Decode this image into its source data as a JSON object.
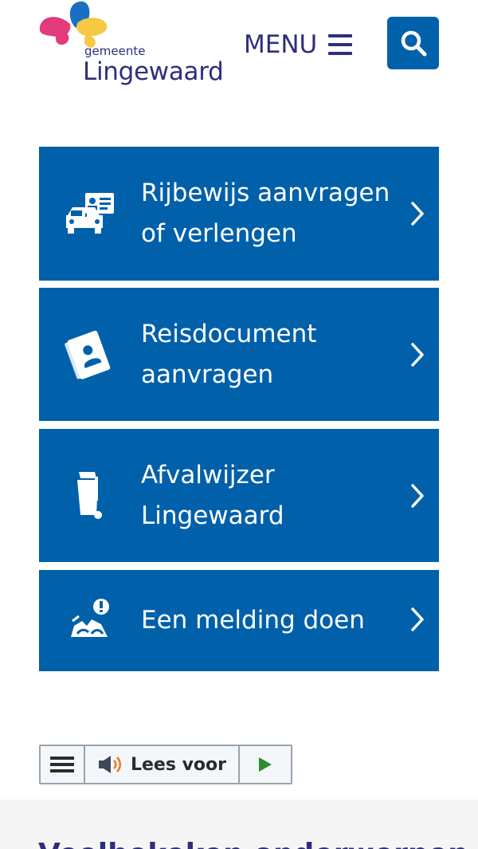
{
  "header": {
    "logo_small": "gemeente",
    "logo_big": "Lingewaard",
    "menu_label": "MENU",
    "search_icon": "search-icon",
    "menu_icon": "hamburger-icon"
  },
  "tiles": [
    {
      "line1": "Rijbewijs aanvragen",
      "line2": "of verlengen",
      "icon": "driving-license-car-icon"
    },
    {
      "line1": "Reisdocument",
      "line2": "aanvragen",
      "icon": "passport-icon"
    },
    {
      "line1": "Afvalwijzer",
      "line2": "Lingewaard",
      "icon": "waste-bin-icon"
    },
    {
      "line1": "Een melding doen",
      "icon": "report-issue-icon"
    }
  ],
  "readspeaker": {
    "label": "Lees voor",
    "menu_icon": "menu-lines-icon",
    "speaker_icon": "speaker-icon",
    "play_icon": "play-icon"
  },
  "colors": {
    "brand_blue": "#0060aa",
    "logo_navy": "#2e2f7c",
    "play_green": "#2e8b2e"
  },
  "footer": {
    "title": "Veelbekeken onderwerpen"
  }
}
